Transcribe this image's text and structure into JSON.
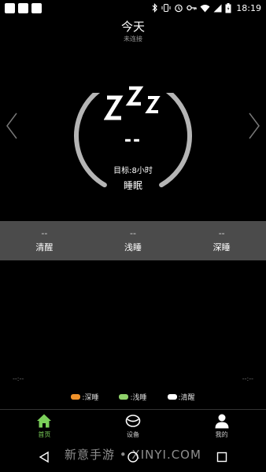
{
  "status_bar": {
    "time": "18:19",
    "icons": [
      "bluetooth-icon",
      "vibrate-icon",
      "alarm-icon",
      "key-icon",
      "wifi-icon",
      "cellular-icon",
      "battery-icon"
    ]
  },
  "header": {
    "title": "今天",
    "subtitle": "未连接"
  },
  "gauge": {
    "value": "--",
    "target": "目标:8小时",
    "label": "睡眠"
  },
  "stats": [
    {
      "value": "--",
      "label": "清醒"
    },
    {
      "value": "--",
      "label": "浅睡"
    },
    {
      "value": "--",
      "label": "深睡"
    }
  ],
  "chart": {
    "start_time": "--:--",
    "end_time": "--:--"
  },
  "legend": [
    {
      "label": ":深睡",
      "color": "#f0922a"
    },
    {
      "label": ":浅睡",
      "color": "#8fd16a"
    },
    {
      "label": ":清醒",
      "color": "#ffffff"
    }
  ],
  "tabs": [
    {
      "label": "首页",
      "icon": "home-icon",
      "active": true
    },
    {
      "label": "设备",
      "icon": "device-icon",
      "active": false
    },
    {
      "label": "我的",
      "icon": "profile-icon",
      "active": false
    }
  ],
  "watermark": "新意手游 • XINYI.COM",
  "colors": {
    "accent": "#7bd05a",
    "band": "#4b4b4b",
    "gauge_arc": "#b5b5b5"
  }
}
